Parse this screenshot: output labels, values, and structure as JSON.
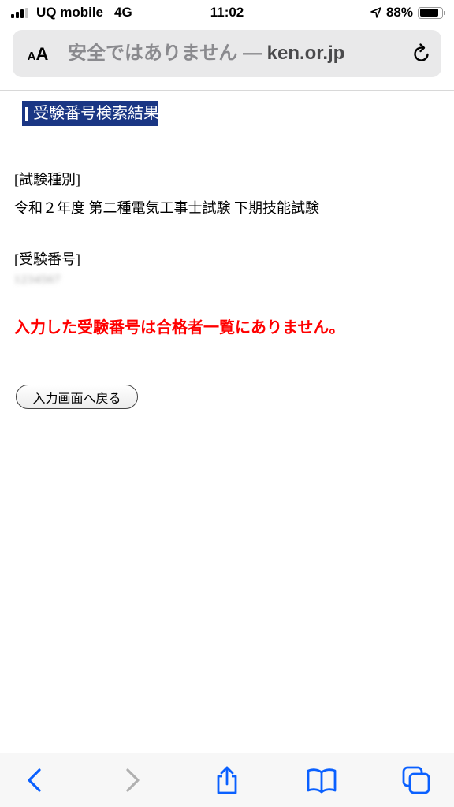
{
  "status_bar": {
    "carrier": "UQ mobile",
    "network": "4G",
    "time": "11:02",
    "battery": "88%",
    "battery_level": 0.88
  },
  "address_bar": {
    "aa_small": "A",
    "aa_large": "A",
    "security_text": "安全ではありません — ",
    "domain": "ken.or.jp"
  },
  "page": {
    "heading": "受験番号検索結果",
    "exam_type_label": "[試験種別]",
    "exam_type_value": "令和２年度 第二種電気工事士試験 下期技能試験",
    "exam_number_label": "[受験番号]",
    "exam_number_value": "1234567",
    "result_message": "入力した受験番号は合格者一覧にありません。",
    "back_button_label": "入力画面へ戻る"
  },
  "colors": {
    "heading_bg": "#1a3684",
    "message": "#ff0000",
    "toolbar_active": "#0a60ff",
    "toolbar_disabled": "#b0b0b0"
  },
  "toolbar": {
    "icons": [
      "back-icon",
      "forward-icon",
      "share-icon",
      "bookmarks-icon",
      "tabs-icon"
    ]
  }
}
